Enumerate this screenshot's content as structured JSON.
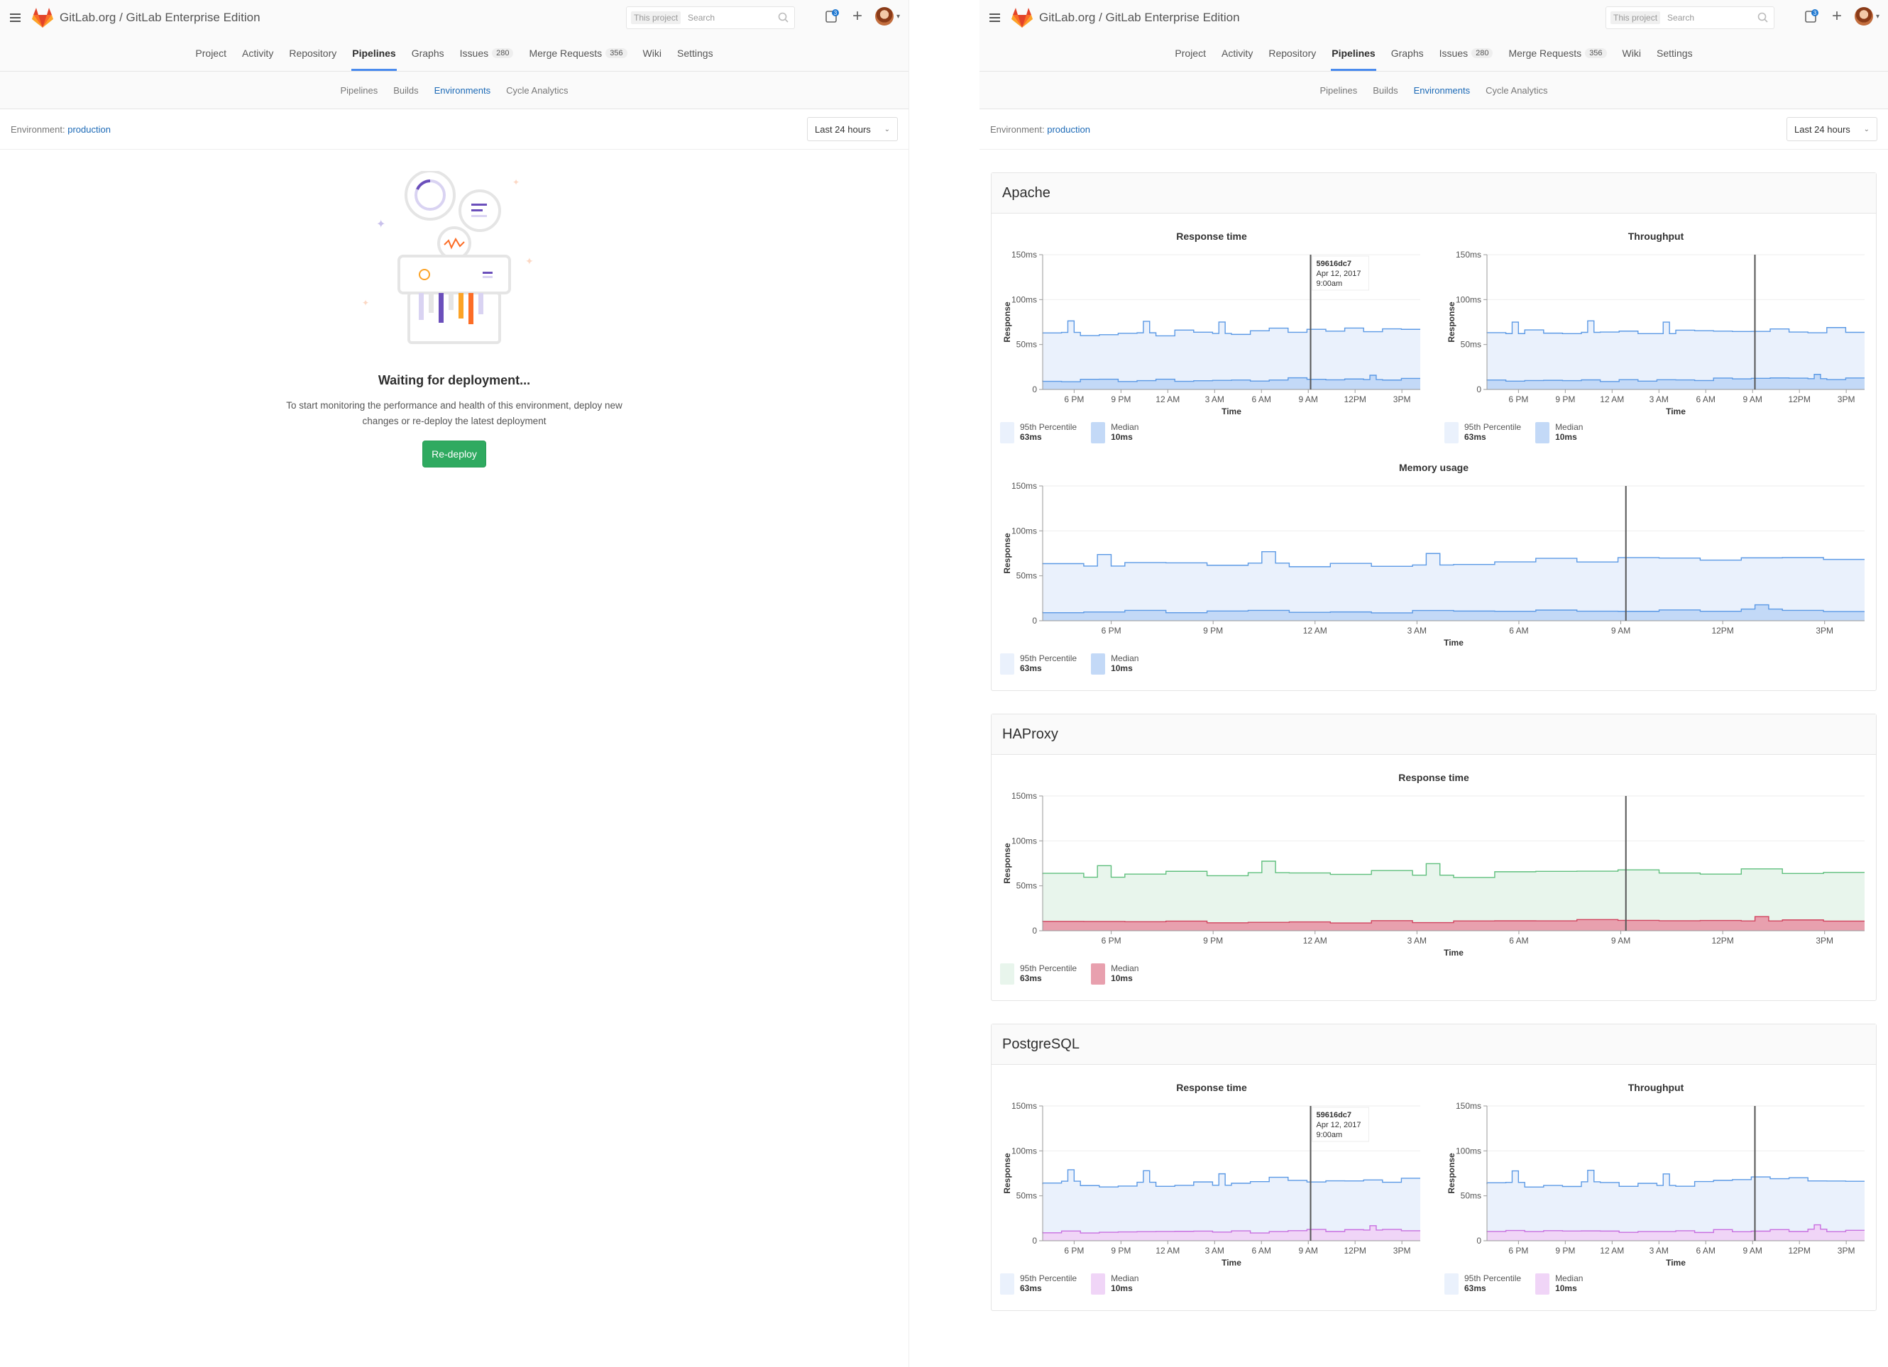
{
  "header": {
    "title": "GitLab.org / GitLab Enterprise Edition",
    "search_scope": "This project",
    "search_placeholder": "Search",
    "todo_count": "3"
  },
  "nav": [
    {
      "label": "Project"
    },
    {
      "label": "Activity"
    },
    {
      "label": "Repository"
    },
    {
      "label": "Pipelines",
      "active": true
    },
    {
      "label": "Graphs"
    },
    {
      "label": "Issues",
      "badge": "280"
    },
    {
      "label": "Merge Requests",
      "badge": "356"
    },
    {
      "label": "Wiki"
    },
    {
      "label": "Settings"
    }
  ],
  "subnav": [
    {
      "label": "Pipelines"
    },
    {
      "label": "Builds"
    },
    {
      "label": "Environments",
      "active": true
    },
    {
      "label": "Cycle Analytics"
    }
  ],
  "env": {
    "label": "Environment:",
    "name": "production",
    "range": "Last 24 hours"
  },
  "empty": {
    "title": "Waiting for deployment...",
    "text": "To start monitoring the performance and health of this environment, deploy new changes or re-deploy the latest deployment",
    "button": "Re-deploy"
  },
  "colors": {
    "blue": "#5b99e5",
    "blue_fill": "#eaf1fc",
    "blue_median": "#c3d9f7",
    "green": "#5fbf7d",
    "green_fill": "#e8f5ec",
    "red": "#d1445f",
    "red_median": "#e8a0ae",
    "purple": "#c86fe0",
    "purple_median": "#f0d5f7"
  },
  "chart_data": [
    {
      "group": "Apache",
      "title": "Response time",
      "type": "area",
      "xlabel": "Time",
      "ylabel": "Response",
      "yticks": [
        "150ms",
        "100ms",
        "50ms",
        "0"
      ],
      "ylim": [
        0,
        150
      ],
      "xticks": [
        "6 PM",
        "9 PM",
        "12 AM",
        "3 AM",
        "6 AM",
        "9 AM",
        "12PM",
        "3PM"
      ],
      "deployment": {
        "x": "9 AM",
        "sha": "59616dc7",
        "date": "Apr 12, 2017",
        "time": "9:00am"
      },
      "series": [
        {
          "name": "95th Percentile",
          "value": "63ms",
          "avg": 63
        },
        {
          "name": "Median",
          "value": "10ms",
          "avg": 10
        }
      ]
    },
    {
      "group": "Apache",
      "title": "Throughput",
      "type": "area",
      "xlabel": "Time",
      "ylabel": "Response",
      "yticks": [
        "150ms",
        "100ms",
        "50ms",
        "0"
      ],
      "ylim": [
        0,
        150
      ],
      "xticks": [
        "6 PM",
        "9 PM",
        "12 AM",
        "3 AM",
        "6 AM",
        "9 AM",
        "12PM",
        "3PM"
      ],
      "deployment": {
        "x": "9 AM"
      },
      "series": [
        {
          "name": "95th Percentile",
          "value": "63ms",
          "avg": 63
        },
        {
          "name": "Median",
          "value": "10ms",
          "avg": 10
        }
      ]
    },
    {
      "group": "Apache",
      "title": "Memory usage",
      "type": "area",
      "xlabel": "Time",
      "ylabel": "Response",
      "yticks": [
        "150ms",
        "100ms",
        "50ms",
        "0"
      ],
      "ylim": [
        0,
        150
      ],
      "xticks": [
        "6 PM",
        "9 PM",
        "12 AM",
        "3 AM",
        "6 AM",
        "9 AM",
        "12PM",
        "3PM"
      ],
      "deployment": {
        "x": "9 AM"
      },
      "series": [
        {
          "name": "95th Percentile",
          "value": "63ms",
          "avg": 63
        },
        {
          "name": "Median",
          "value": "10ms",
          "avg": 10
        }
      ]
    },
    {
      "group": "HAProxy",
      "title": "Response time",
      "type": "area",
      "xlabel": "Time",
      "ylabel": "Response",
      "yticks": [
        "150ms",
        "100ms",
        "50ms",
        "0"
      ],
      "ylim": [
        0,
        150
      ],
      "xticks": [
        "6 PM",
        "9 PM",
        "12 AM",
        "3 AM",
        "6 AM",
        "9 AM",
        "12PM",
        "3PM"
      ],
      "deployment": {
        "x": "9 AM"
      },
      "series": [
        {
          "name": "95th Percentile",
          "value": "63ms",
          "avg": 63
        },
        {
          "name": "Median",
          "value": "10ms",
          "avg": 10
        }
      ]
    },
    {
      "group": "PostgreSQL",
      "title": "Response time",
      "type": "area",
      "xlabel": "Time",
      "ylabel": "Response",
      "yticks": [
        "150ms",
        "100ms",
        "50ms",
        "0"
      ],
      "ylim": [
        0,
        150
      ],
      "xticks": [
        "6 PM",
        "9 PM",
        "12 AM",
        "3 AM",
        "6 AM",
        "9 AM",
        "12PM",
        "3PM"
      ],
      "deployment": {
        "x": "9 AM",
        "sha": "59616dc7",
        "date": "Apr 12, 2017",
        "time": "9:00am"
      },
      "series": [
        {
          "name": "95th Percentile",
          "value": "63ms",
          "avg": 63
        },
        {
          "name": "Median",
          "value": "10ms",
          "avg": 10
        }
      ]
    },
    {
      "group": "PostgreSQL",
      "title": "Throughput",
      "type": "area",
      "xlabel": "Time",
      "ylabel": "Response",
      "yticks": [
        "150ms",
        "100ms",
        "50ms",
        "0"
      ],
      "ylim": [
        0,
        150
      ],
      "xticks": [
        "6 PM",
        "9 PM",
        "12 AM",
        "3 AM",
        "6 AM",
        "9 AM",
        "12PM",
        "3PM"
      ],
      "deployment": {
        "x": "9 AM"
      },
      "series": [
        {
          "name": "95th Percentile",
          "value": "63ms",
          "avg": 63
        },
        {
          "name": "Median",
          "value": "10ms",
          "avg": 10
        }
      ]
    }
  ]
}
